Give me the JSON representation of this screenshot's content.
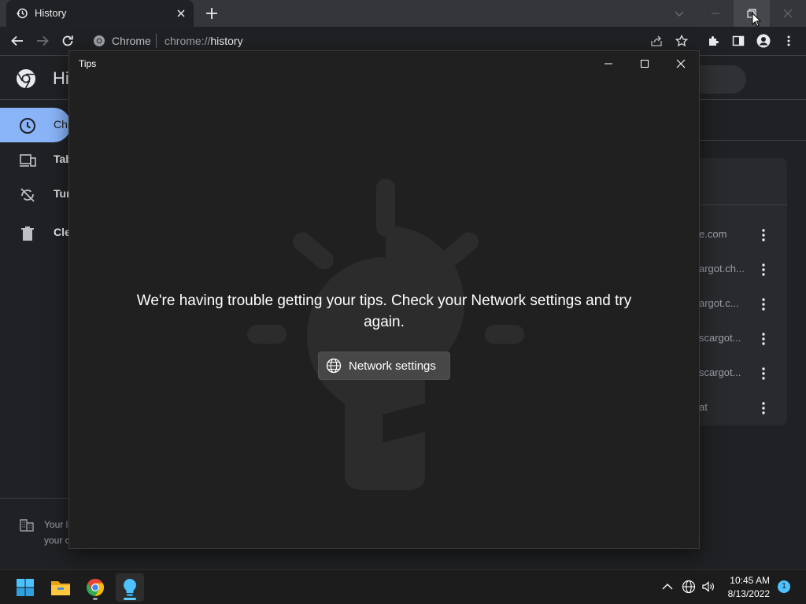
{
  "browser": {
    "tab_title": "History",
    "omnibox_chip": "Chrome",
    "url_scheme": "chrome://",
    "url_host": "history"
  },
  "history_page": {
    "title": "Hi",
    "sidebar": [
      {
        "label": "Chr",
        "icon": "clock-icon",
        "active": true
      },
      {
        "label": "Tab",
        "icon": "devices-icon",
        "active": false
      },
      {
        "label": "Tur",
        "icon": "sync-off-icon",
        "active": false
      },
      {
        "label": "Cle",
        "icon": "trash-icon",
        "active": false
      }
    ],
    "footer_lines": [
      "Your l",
      "your c"
    ],
    "rows": [
      "e.com",
      "argot.ch...",
      "argot.c...",
      "scargot...",
      "scargot...",
      "at"
    ]
  },
  "tips_window": {
    "title": "Tips",
    "message": "We're having trouble getting your tips. Check your Network settings and try again.",
    "button_label": "Network settings"
  },
  "taskbar": {
    "time": "10:45 AM",
    "date": "8/13/2022",
    "notification_count": "1"
  },
  "colors": {
    "accent": "#8ab4f8",
    "taskbar_accent": "#60cdff"
  }
}
